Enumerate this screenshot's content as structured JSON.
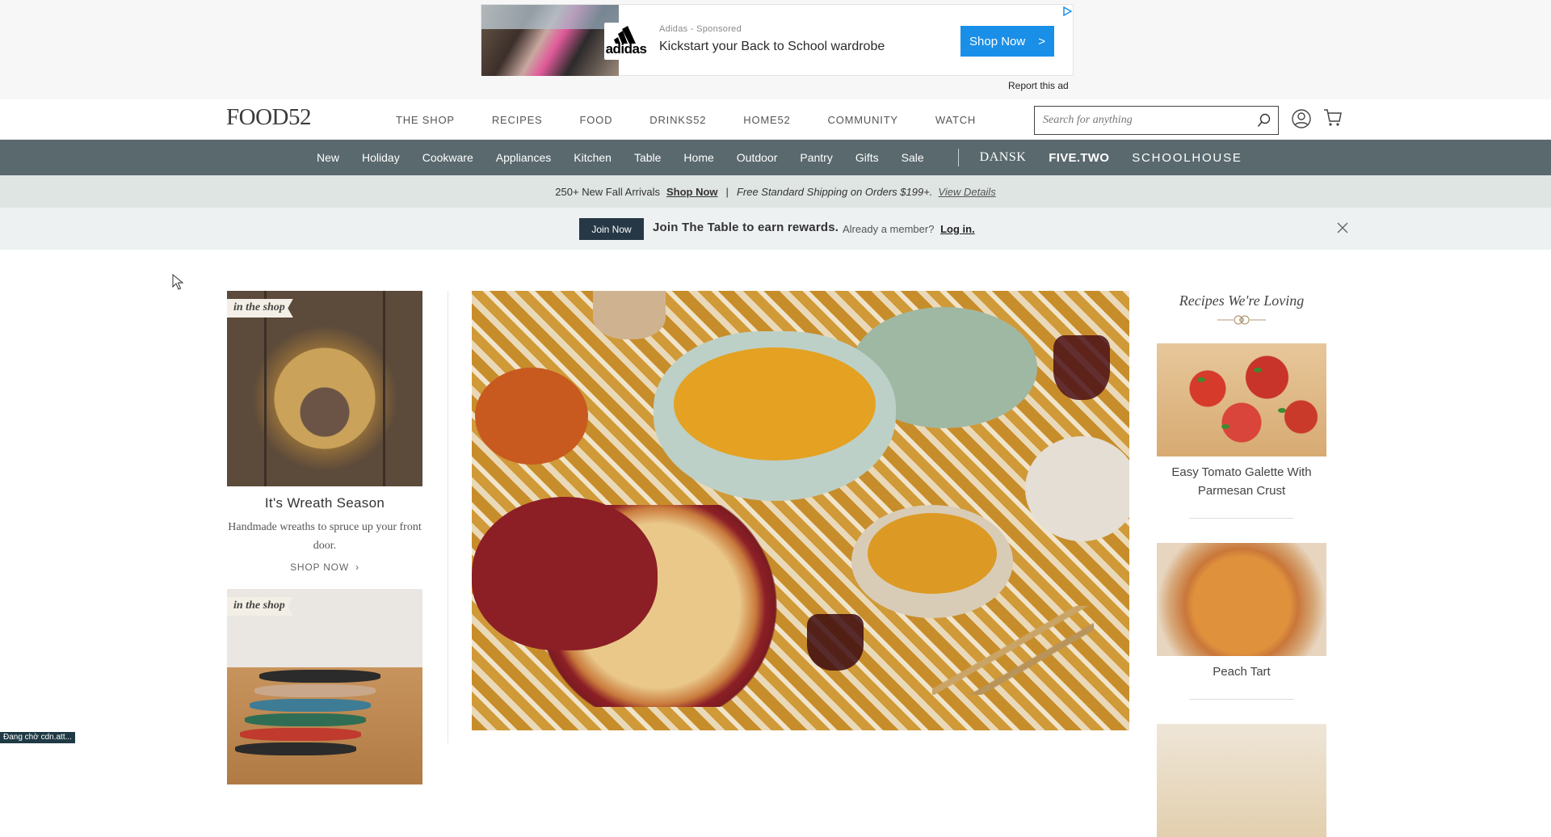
{
  "ad": {
    "sponsor": "Adidas - Sponsored",
    "brand_word": "adidas",
    "headline": "Kickstart your Back to School wardrobe",
    "cta": "Shop Now",
    "cta_arrow": ">",
    "report": "Report this ad",
    "accent": "#1a8fe8"
  },
  "header": {
    "logo": "FOOD52",
    "nav": [
      "THE SHOP",
      "RECIPES",
      "FOOD",
      "DRINKS52",
      "HOME52",
      "COMMUNITY",
      "WATCH"
    ],
    "search_placeholder": "Search for anything",
    "icons": {
      "search": "search-icon",
      "account": "account-icon",
      "cart": "cart-icon"
    }
  },
  "categories": {
    "items": [
      "New",
      "Holiday",
      "Cookware",
      "Appliances",
      "Kitchen",
      "Table",
      "Home",
      "Outdoor",
      "Pantry",
      "Gifts",
      "Sale"
    ],
    "brands": [
      "DANSK",
      "FIVE.TWO",
      "SCHOOLHOUSE"
    ],
    "bar_color": "#59696e"
  },
  "promo": {
    "arrivals": "250+ New Fall Arrivals",
    "shop_now": "Shop Now",
    "separator": "|",
    "shipping": "Free Standard Shipping on Orders $199+.",
    "details": "View Details"
  },
  "rewards": {
    "join": "Join Now",
    "message": "Join The Table to earn rewards.",
    "member": "Already a member?",
    "login": "Log in."
  },
  "left_cards": [
    {
      "tag": "in the shop",
      "title": "It's Wreath Season",
      "desc": "Handmade wreaths to spruce up your front door.",
      "cta": "SHOP NOW"
    },
    {
      "tag": "in the shop"
    }
  ],
  "right": {
    "title": "Recipes We're Loving",
    "recipes": [
      {
        "title": "Easy Tomato Galette With Parmesan Crust"
      },
      {
        "title": "Peach Tart"
      }
    ]
  },
  "status": "Đang chờ cdn.att..."
}
